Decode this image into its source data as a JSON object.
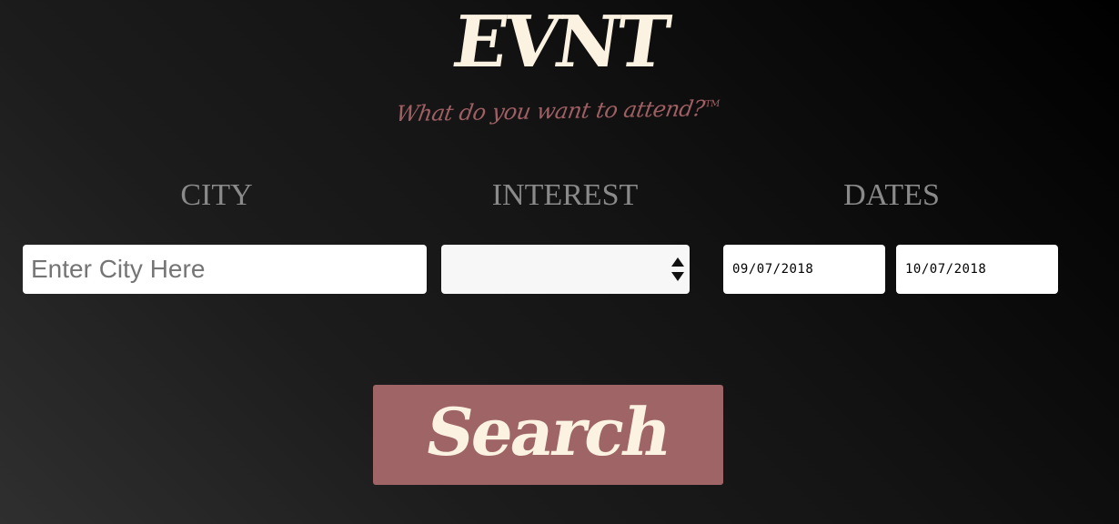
{
  "header": {
    "logo_text": "EVNT",
    "tagline": "What do you want to attend?",
    "tagline_mark": "TM"
  },
  "form": {
    "city": {
      "label": "CITY",
      "placeholder": "Enter City Here",
      "value": ""
    },
    "interest": {
      "label": "INTEREST",
      "selected": ""
    },
    "dates": {
      "label": "DATES",
      "start": "09/07/2018",
      "end": "10/07/2018"
    },
    "search_label": "Search"
  },
  "colors": {
    "logo": "#fbf2e2",
    "accent": "#9e6466",
    "label": "#8a8a8a"
  },
  "icons": {
    "select": "up-down-arrows-icon"
  }
}
